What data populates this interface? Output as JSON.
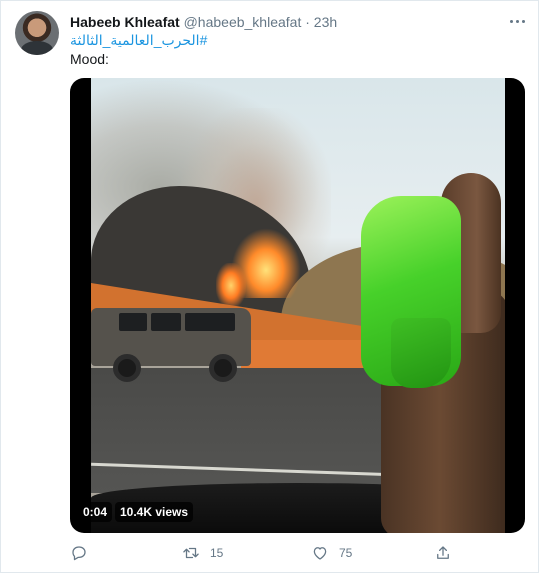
{
  "tweet": {
    "author_name": "Habeeb Khleafat",
    "author_handle": "@habeeb_khleafat",
    "separator": "·",
    "timestamp": "23h",
    "hashtag": "#الحرب_العالمية_الثالثة",
    "text": "Mood:"
  },
  "video": {
    "duration": "0:04",
    "views": "10.4K views"
  },
  "actions": {
    "reply_count": "",
    "retweet_count": "15",
    "like_count": "75"
  },
  "icons": {
    "more": "more-horizontal-icon",
    "reply": "reply-icon",
    "retweet": "retweet-icon",
    "like": "heart-icon",
    "share": "share-icon"
  },
  "colors": {
    "link": "#1b95e0",
    "secondary_text": "#657786",
    "primary_text": "#14171a"
  }
}
